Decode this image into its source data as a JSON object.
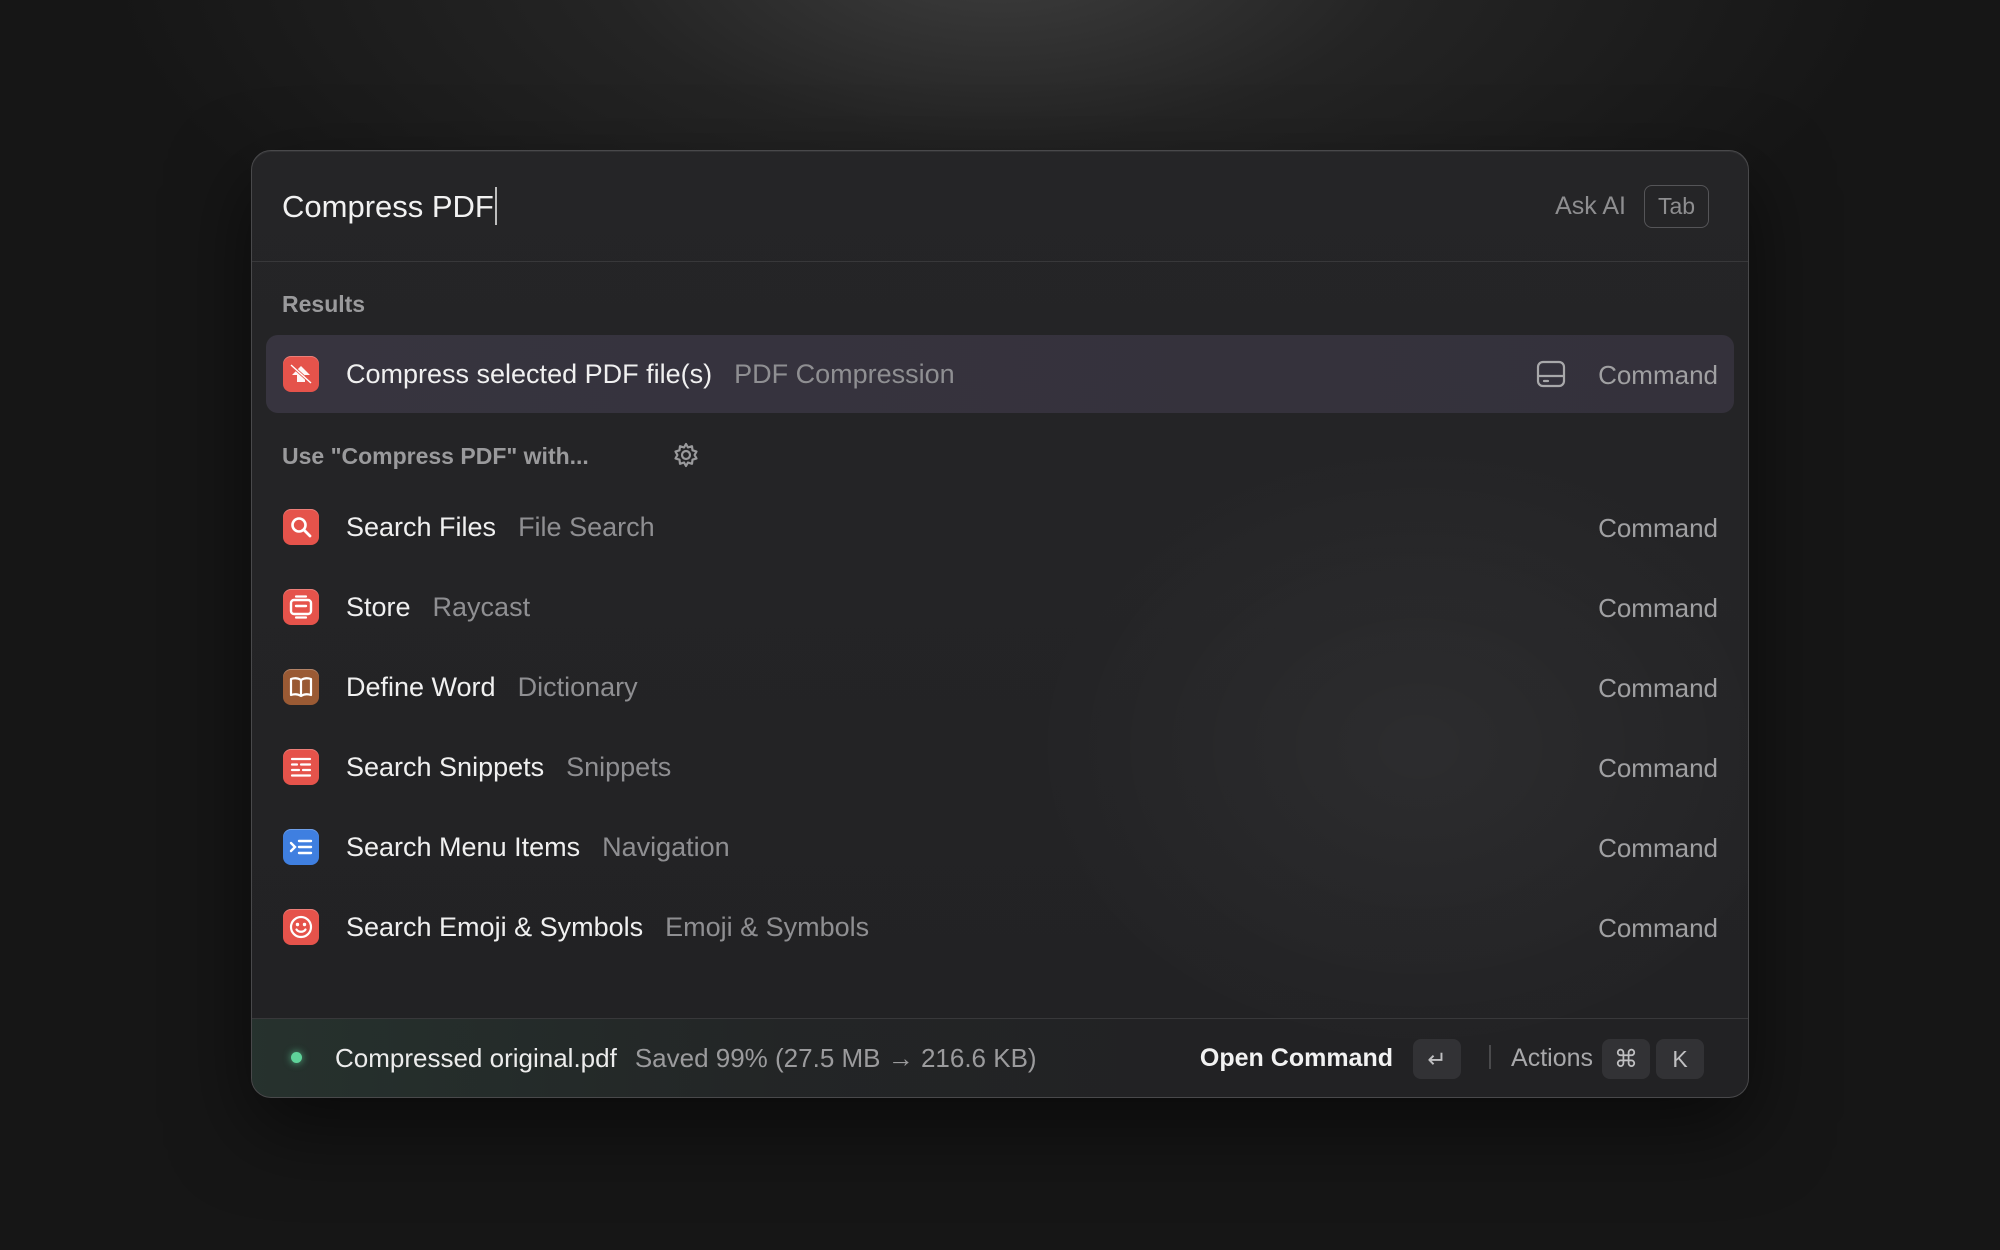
{
  "search": {
    "value": "Compress PDF",
    "ask_ai": "Ask AI",
    "tab_key": "Tab"
  },
  "sections": {
    "results_title": "Results",
    "fallback_title": "Use \"Compress PDF\" with..."
  },
  "results": [
    {
      "title": "Compress selected PDF file(s)",
      "subtitle": "PDF Compression",
      "type": "Command",
      "icon": "compress-pdf-icon",
      "color": "#e5534b"
    }
  ],
  "fallbacks": [
    {
      "title": "Search Files",
      "subtitle": "File Search",
      "type": "Command",
      "icon": "magnifier-icon",
      "color": "#e5534b"
    },
    {
      "title": "Store",
      "subtitle": "Raycast",
      "type": "Command",
      "icon": "store-icon",
      "color": "#e5534b"
    },
    {
      "title": "Define Word",
      "subtitle": "Dictionary",
      "type": "Command",
      "icon": "book-icon",
      "color": "#9a5a34"
    },
    {
      "title": "Search Snippets",
      "subtitle": "Snippets",
      "type": "Command",
      "icon": "snippets-icon",
      "color": "#e5534b"
    },
    {
      "title": "Search Menu Items",
      "subtitle": "Navigation",
      "type": "Command",
      "icon": "menu-items-icon",
      "color": "#3f7fe0"
    },
    {
      "title": "Search Emoji & Symbols",
      "subtitle": "Emoji & Symbols",
      "type": "Command",
      "icon": "emoji-icon",
      "color": "#e5534b"
    }
  ],
  "footer": {
    "status_text": "Compressed original.pdf",
    "status_detail": "Saved 99% (27.5 MB → 216.6 KB)",
    "primary_action": "Open Command",
    "enter_key": "↵",
    "actions_label": "Actions",
    "cmd_key": "⌘",
    "k_key": "K",
    "status_color": "#5fd39a"
  }
}
